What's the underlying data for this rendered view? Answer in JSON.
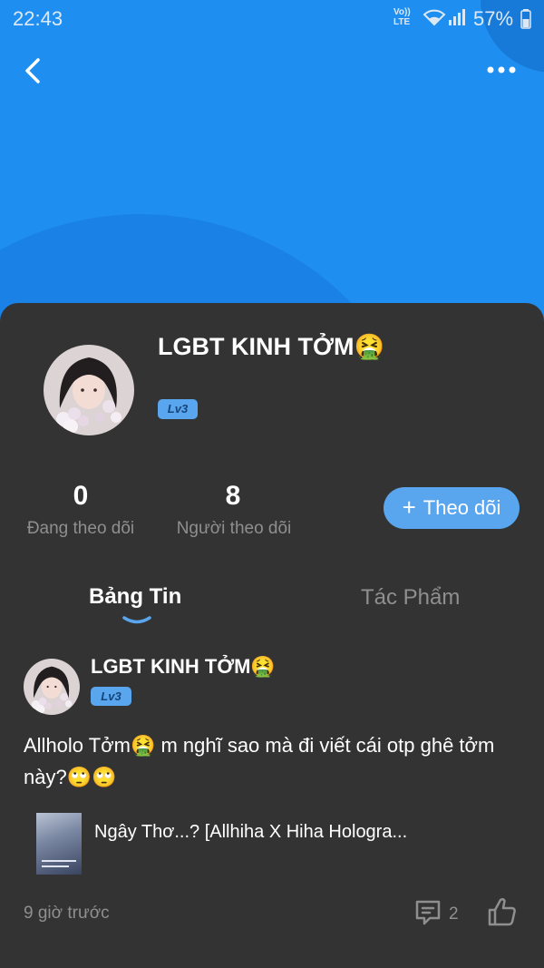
{
  "status_bar": {
    "time": "22:43",
    "volte_line1": "Vo))",
    "volte_line2": "LTE",
    "battery": "57%"
  },
  "colors": {
    "header_blue": "#1E8FF0",
    "card_bg": "#333333",
    "accent": "#5AA6EE",
    "muted_text": "#8f8f8f"
  },
  "header": {
    "back_icon": "chevron-left-icon",
    "more_icon": "more-horizontal-icon"
  },
  "profile": {
    "name": "LGBT KINH TỞM🤮",
    "level": "Lv3",
    "following_count": "0",
    "following_label": "Đang theo dõi",
    "followers_count": "8",
    "followers_label": "Người theo dõi",
    "follow_button_icon": "+",
    "follow_button": "Theo dõi"
  },
  "tabs": [
    {
      "label": "Bảng Tin",
      "active": true
    },
    {
      "label": "Tác Phẩm",
      "active": false
    }
  ],
  "post": {
    "author": "LGBT KINH TỞM🤮",
    "level": "Lv3",
    "text": "Allholo Tởm🤮 m nghĩ sao mà đi viết cái otp ghê tởm này?🙄🙄",
    "linked_work_title": "Ngây Thơ...? [Allhiha X Hiha Hologra...",
    "time": "9 giờ trước",
    "comment_count": "2"
  }
}
